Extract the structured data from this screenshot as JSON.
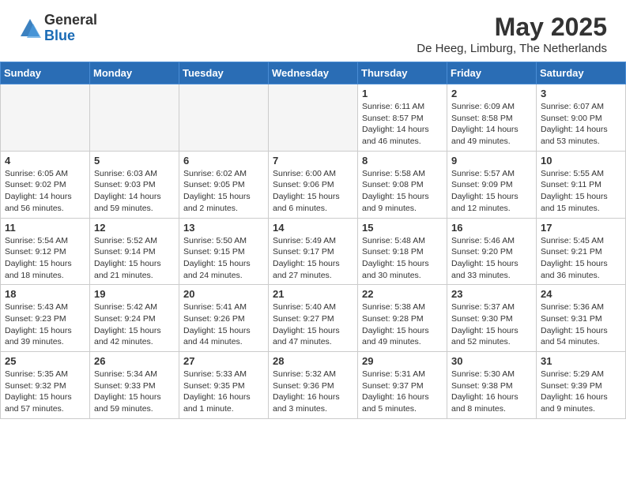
{
  "header": {
    "logo_general": "General",
    "logo_blue": "Blue",
    "month_title": "May 2025",
    "location": "De Heeg, Limburg, The Netherlands"
  },
  "days_of_week": [
    "Sunday",
    "Monday",
    "Tuesday",
    "Wednesday",
    "Thursday",
    "Friday",
    "Saturday"
  ],
  "weeks": [
    [
      {
        "day": "",
        "info": ""
      },
      {
        "day": "",
        "info": ""
      },
      {
        "day": "",
        "info": ""
      },
      {
        "day": "",
        "info": ""
      },
      {
        "day": "1",
        "info": "Sunrise: 6:11 AM\nSunset: 8:57 PM\nDaylight: 14 hours\nand 46 minutes."
      },
      {
        "day": "2",
        "info": "Sunrise: 6:09 AM\nSunset: 8:58 PM\nDaylight: 14 hours\nand 49 minutes."
      },
      {
        "day": "3",
        "info": "Sunrise: 6:07 AM\nSunset: 9:00 PM\nDaylight: 14 hours\nand 53 minutes."
      }
    ],
    [
      {
        "day": "4",
        "info": "Sunrise: 6:05 AM\nSunset: 9:02 PM\nDaylight: 14 hours\nand 56 minutes."
      },
      {
        "day": "5",
        "info": "Sunrise: 6:03 AM\nSunset: 9:03 PM\nDaylight: 14 hours\nand 59 minutes."
      },
      {
        "day": "6",
        "info": "Sunrise: 6:02 AM\nSunset: 9:05 PM\nDaylight: 15 hours\nand 2 minutes."
      },
      {
        "day": "7",
        "info": "Sunrise: 6:00 AM\nSunset: 9:06 PM\nDaylight: 15 hours\nand 6 minutes."
      },
      {
        "day": "8",
        "info": "Sunrise: 5:58 AM\nSunset: 9:08 PM\nDaylight: 15 hours\nand 9 minutes."
      },
      {
        "day": "9",
        "info": "Sunrise: 5:57 AM\nSunset: 9:09 PM\nDaylight: 15 hours\nand 12 minutes."
      },
      {
        "day": "10",
        "info": "Sunrise: 5:55 AM\nSunset: 9:11 PM\nDaylight: 15 hours\nand 15 minutes."
      }
    ],
    [
      {
        "day": "11",
        "info": "Sunrise: 5:54 AM\nSunset: 9:12 PM\nDaylight: 15 hours\nand 18 minutes."
      },
      {
        "day": "12",
        "info": "Sunrise: 5:52 AM\nSunset: 9:14 PM\nDaylight: 15 hours\nand 21 minutes."
      },
      {
        "day": "13",
        "info": "Sunrise: 5:50 AM\nSunset: 9:15 PM\nDaylight: 15 hours\nand 24 minutes."
      },
      {
        "day": "14",
        "info": "Sunrise: 5:49 AM\nSunset: 9:17 PM\nDaylight: 15 hours\nand 27 minutes."
      },
      {
        "day": "15",
        "info": "Sunrise: 5:48 AM\nSunset: 9:18 PM\nDaylight: 15 hours\nand 30 minutes."
      },
      {
        "day": "16",
        "info": "Sunrise: 5:46 AM\nSunset: 9:20 PM\nDaylight: 15 hours\nand 33 minutes."
      },
      {
        "day": "17",
        "info": "Sunrise: 5:45 AM\nSunset: 9:21 PM\nDaylight: 15 hours\nand 36 minutes."
      }
    ],
    [
      {
        "day": "18",
        "info": "Sunrise: 5:43 AM\nSunset: 9:23 PM\nDaylight: 15 hours\nand 39 minutes."
      },
      {
        "day": "19",
        "info": "Sunrise: 5:42 AM\nSunset: 9:24 PM\nDaylight: 15 hours\nand 42 minutes."
      },
      {
        "day": "20",
        "info": "Sunrise: 5:41 AM\nSunset: 9:26 PM\nDaylight: 15 hours\nand 44 minutes."
      },
      {
        "day": "21",
        "info": "Sunrise: 5:40 AM\nSunset: 9:27 PM\nDaylight: 15 hours\nand 47 minutes."
      },
      {
        "day": "22",
        "info": "Sunrise: 5:38 AM\nSunset: 9:28 PM\nDaylight: 15 hours\nand 49 minutes."
      },
      {
        "day": "23",
        "info": "Sunrise: 5:37 AM\nSunset: 9:30 PM\nDaylight: 15 hours\nand 52 minutes."
      },
      {
        "day": "24",
        "info": "Sunrise: 5:36 AM\nSunset: 9:31 PM\nDaylight: 15 hours\nand 54 minutes."
      }
    ],
    [
      {
        "day": "25",
        "info": "Sunrise: 5:35 AM\nSunset: 9:32 PM\nDaylight: 15 hours\nand 57 minutes."
      },
      {
        "day": "26",
        "info": "Sunrise: 5:34 AM\nSunset: 9:33 PM\nDaylight: 15 hours\nand 59 minutes."
      },
      {
        "day": "27",
        "info": "Sunrise: 5:33 AM\nSunset: 9:35 PM\nDaylight: 16 hours\nand 1 minute."
      },
      {
        "day": "28",
        "info": "Sunrise: 5:32 AM\nSunset: 9:36 PM\nDaylight: 16 hours\nand 3 minutes."
      },
      {
        "day": "29",
        "info": "Sunrise: 5:31 AM\nSunset: 9:37 PM\nDaylight: 16 hours\nand 5 minutes."
      },
      {
        "day": "30",
        "info": "Sunrise: 5:30 AM\nSunset: 9:38 PM\nDaylight: 16 hours\nand 8 minutes."
      },
      {
        "day": "31",
        "info": "Sunrise: 5:29 AM\nSunset: 9:39 PM\nDaylight: 16 hours\nand 9 minutes."
      }
    ]
  ]
}
